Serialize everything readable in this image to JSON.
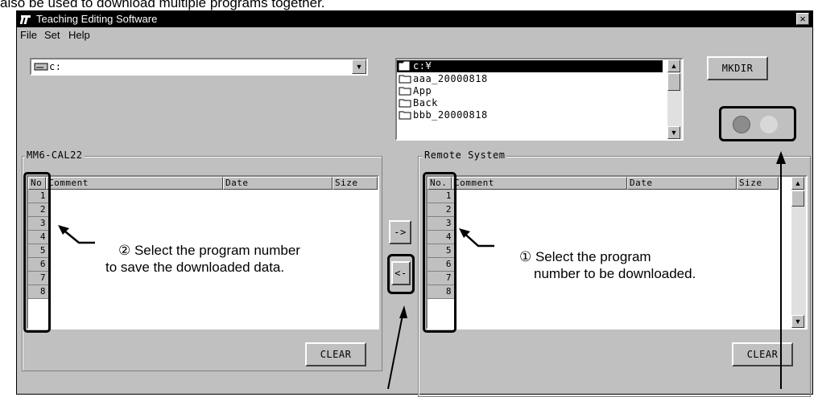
{
  "caption": "also be used to download multiple programs together.",
  "window": {
    "title": "Teaching Editing Software",
    "close_label": "×",
    "menu": [
      "File",
      "Set",
      "Help"
    ]
  },
  "drive_select": {
    "value": "c:"
  },
  "dir_list": {
    "selected": "c:¥",
    "items": [
      "aaa_20000818",
      "App",
      "Back",
      "bbb_20000818"
    ]
  },
  "mkdir_label": "MKDIR",
  "status": {
    "lamps": [
      "gray",
      "light-gray"
    ],
    "colors": {
      "lamp1": "#8c8c8c",
      "lamp2": "#d8d8d8"
    }
  },
  "left_panel": {
    "group_label": "MM6-CAL22",
    "columns": [
      "No",
      "Comment",
      "Date",
      "Size"
    ],
    "rows": [
      "1",
      "2",
      "3",
      "4",
      "5",
      "6",
      "7",
      "8"
    ],
    "clear_label": "CLEAR"
  },
  "right_panel": {
    "group_label": "Remote System",
    "columns": [
      "No.",
      "Comment",
      "Date",
      "Size"
    ],
    "rows": [
      "1",
      "2",
      "3",
      "4",
      "5",
      "6",
      "7",
      "8"
    ],
    "clear_label": "CLEAR"
  },
  "transfer": {
    "to_remote": "->",
    "to_local": "<-"
  },
  "annotations": {
    "left_line1": "② Select the program number",
    "left_line2": "to save the downloaded data.",
    "right_line1": "① Select the program",
    "right_line2": "number to be downloaded."
  }
}
